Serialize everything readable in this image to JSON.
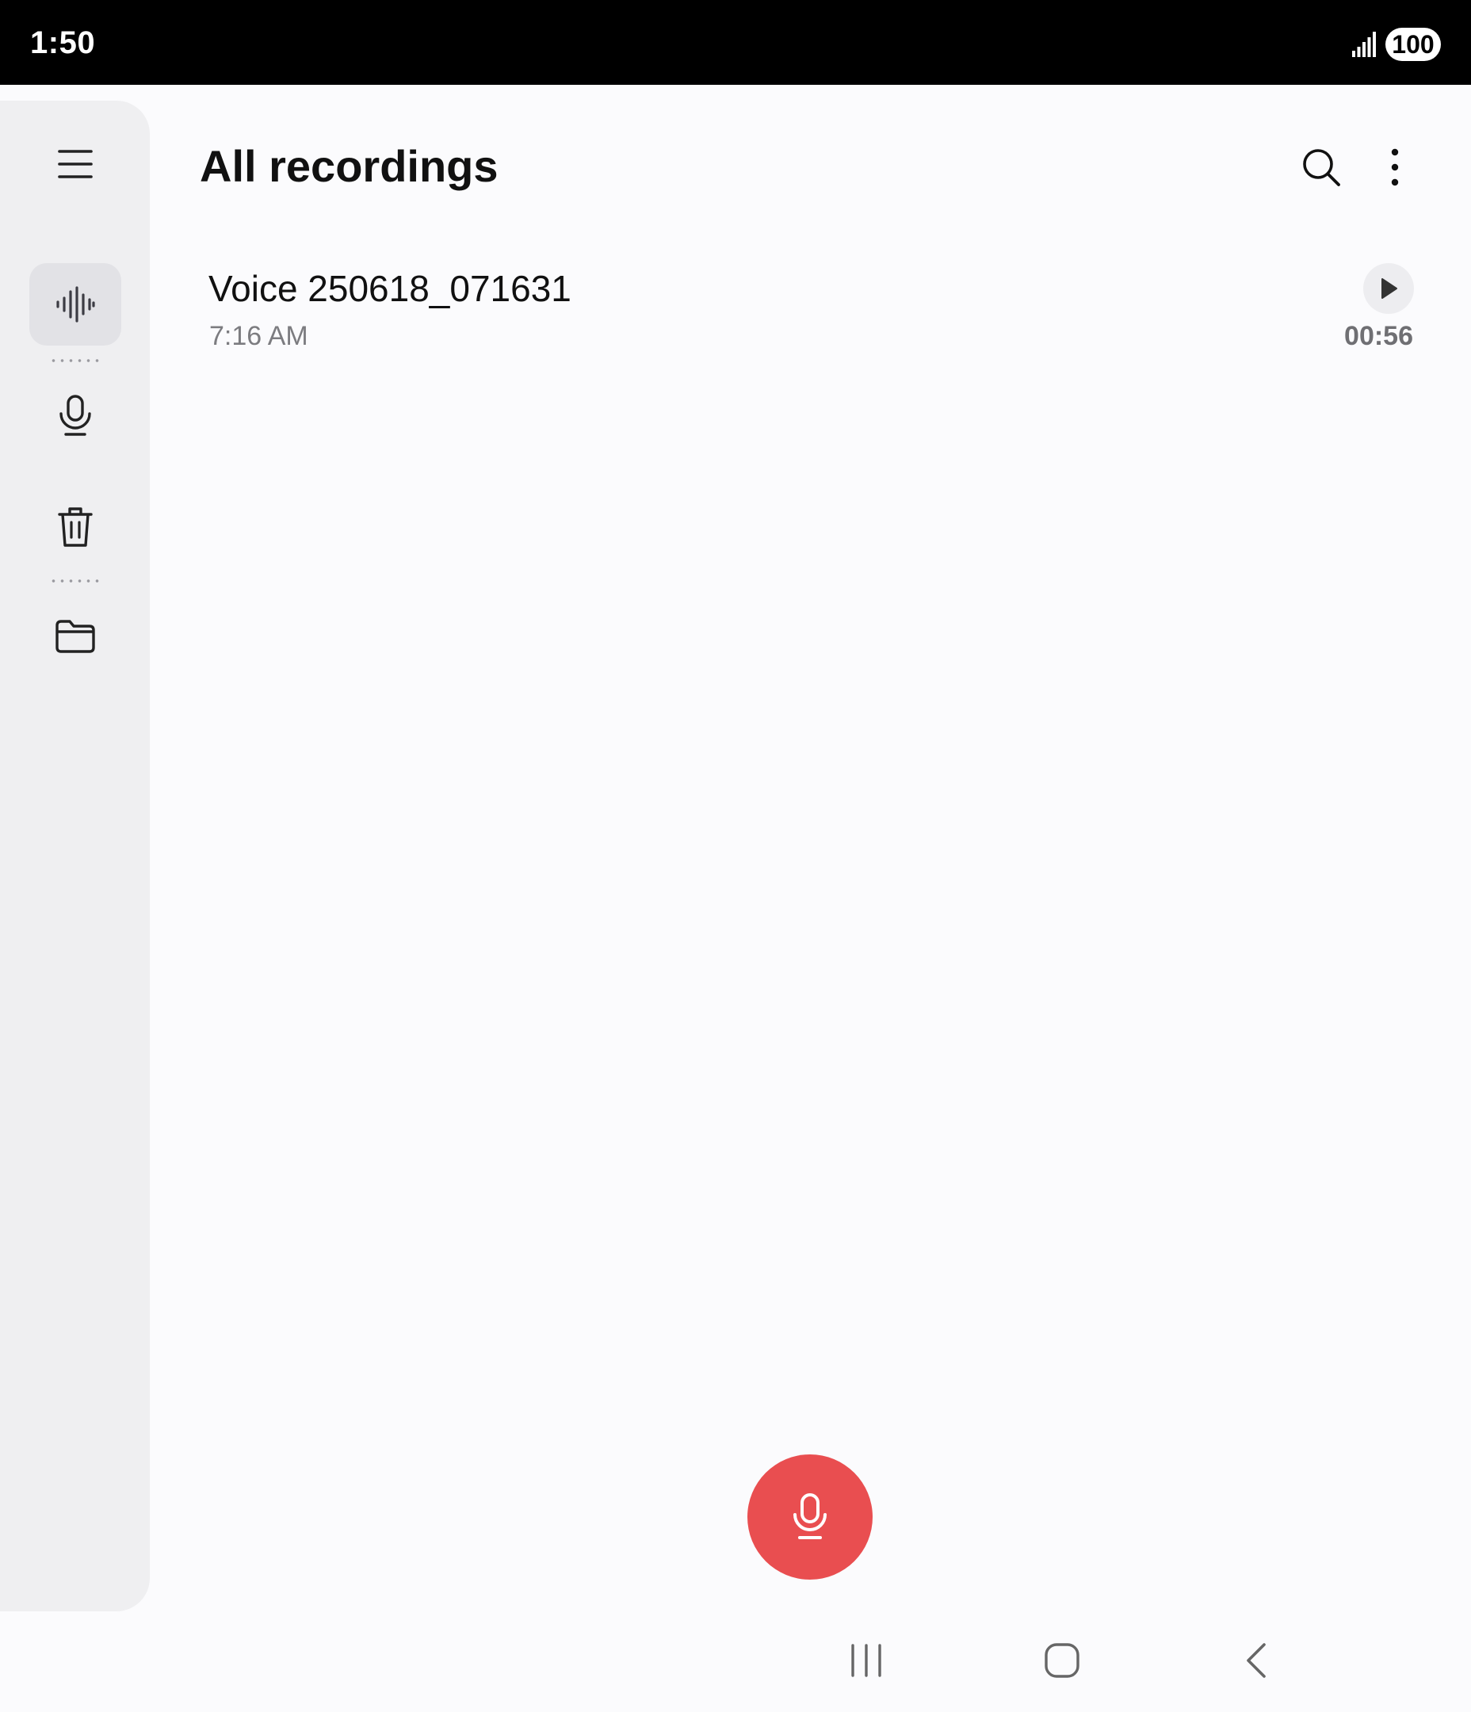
{
  "status_bar": {
    "time": "1:50",
    "signal_icon": "signal-strength-icon",
    "battery": "100"
  },
  "nav_rail": {
    "items": [
      {
        "name": "menu",
        "icon": "hamburger-menu-icon"
      },
      {
        "name": "all-recordings",
        "icon": "waveform-icon",
        "active": true
      },
      {
        "name": "recording",
        "icon": "microphone-icon"
      },
      {
        "name": "trash",
        "icon": "trash-icon"
      },
      {
        "name": "folders",
        "icon": "folder-icon"
      }
    ]
  },
  "app_bar": {
    "title": "All recordings",
    "search_icon": "search-icon",
    "more_icon": "more-options-icon"
  },
  "recordings": [
    {
      "title": "Voice 250618_071631",
      "time": "7:16 AM",
      "duration": "00:56",
      "play_icon": "play-icon"
    }
  ],
  "record_button": {
    "icon": "microphone-icon",
    "color": "#e94e50"
  },
  "system_nav": {
    "recents_icon": "recents-icon",
    "home_icon": "home-icon",
    "back_icon": "back-icon"
  },
  "colors": {
    "background": "#fbfbfd",
    "rail_background": "#efeff1",
    "rail_active": "#e2e2e6",
    "accent_red": "#e94e50"
  }
}
